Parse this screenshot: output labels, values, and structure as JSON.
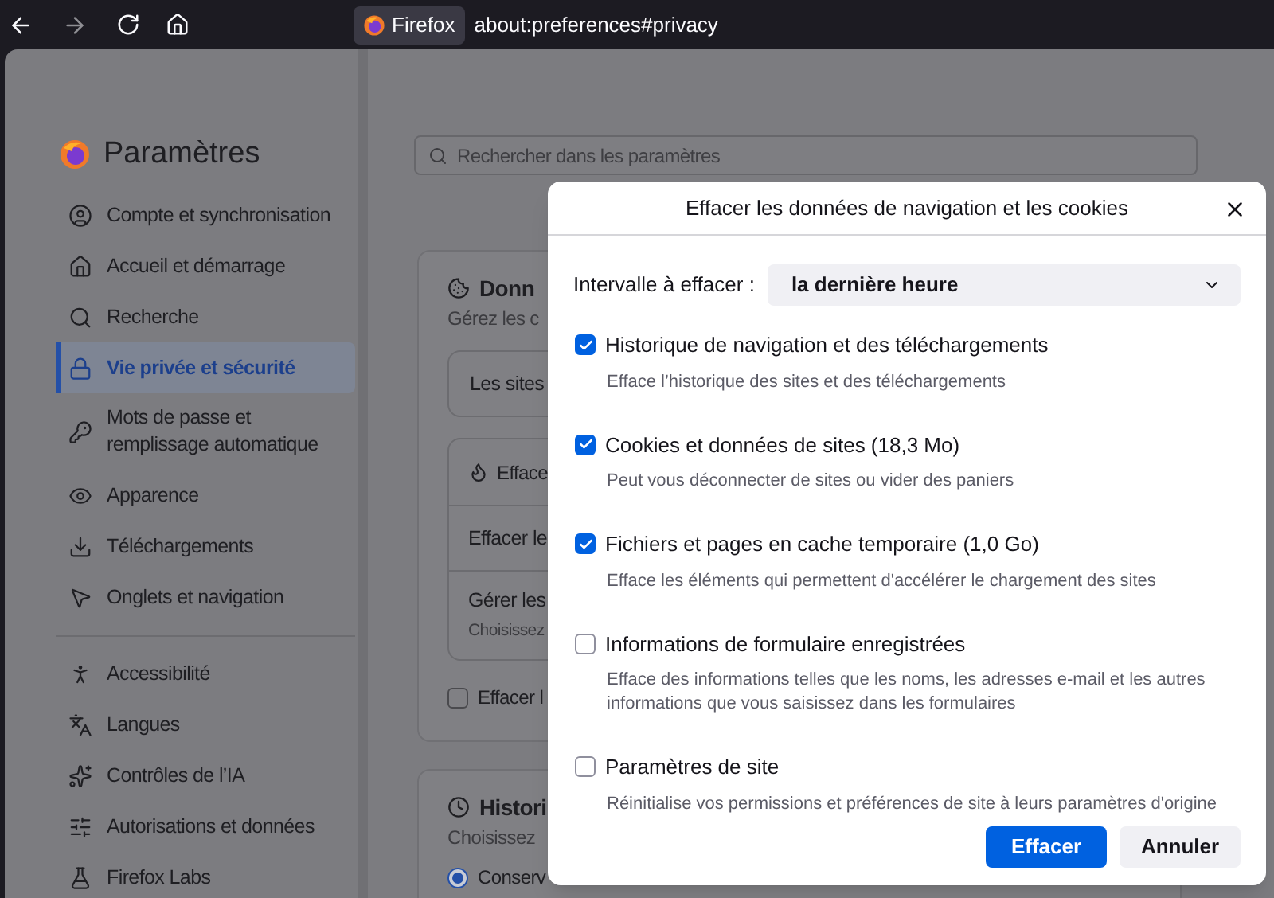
{
  "browser": {
    "identity": "Firefox",
    "url": "about:preferences#privacy"
  },
  "sidebar": {
    "title": "Paramètres",
    "groups": [
      [
        {
          "label": "Compte et synchronisation",
          "selected": false
        },
        {
          "label": "Accueil et démarrage",
          "selected": false
        },
        {
          "label": "Recherche",
          "selected": false
        },
        {
          "label": "Vie privée et sécurité",
          "selected": true
        },
        {
          "label": "Mots de passe et remplissage automatique",
          "selected": false
        },
        {
          "label": "Apparence",
          "selected": false
        },
        {
          "label": "Téléchargements",
          "selected": false
        },
        {
          "label": "Onglets et navigation",
          "selected": false
        }
      ],
      [
        {
          "label": "Accessibilité",
          "selected": false
        },
        {
          "label": "Langues",
          "selected": false
        },
        {
          "label": "Contrôles de l’IA",
          "selected": false
        },
        {
          "label": "Autorisations et données",
          "selected": false
        },
        {
          "label": "Firefox Labs",
          "selected": false
        }
      ]
    ]
  },
  "search": {
    "placeholder": "Rechercher dans les paramètres"
  },
  "content": {
    "data_card": {
      "title": "Donn",
      "subtitle": "Gérez les c",
      "sites_box": "Les sites",
      "rows": [
        {
          "label": "Efface"
        },
        {
          "label": "Effacer le"
        },
        {
          "label": "Gérer les",
          "sub": "Choisissez"
        }
      ],
      "checkbox": {
        "label": "Effacer l",
        "checked": false
      }
    },
    "history_card": {
      "title": "Histori",
      "subtitle": "Choisissez",
      "radio": {
        "label": "Conserv",
        "selected": true
      }
    }
  },
  "dialog": {
    "title": "Effacer les données de navigation et les cookies",
    "range_label": "Intervalle à effacer :",
    "range_value": "la dernière heure",
    "options": [
      {
        "label": "Historique de navigation et des téléchargements",
        "description": "Efface l’historique des sites et des téléchargements",
        "checked": true
      },
      {
        "label": "Cookies et données de sites (18,3 Mo)",
        "description": "Peut vous déconnecter de sites ou vider des paniers",
        "checked": true
      },
      {
        "label": "Fichiers et pages en cache temporaire (1,0 Go)",
        "description": "Efface les éléments qui permettent d'accélérer le chargement des sites",
        "checked": true
      },
      {
        "label": "Informations de formulaire enregistrées",
        "description": "Efface des informations telles que les noms, les adresses e-mail et les autres informations que vous saisissez dans les formulaires",
        "checked": false
      },
      {
        "label": "Paramètres de site",
        "description": "Réinitialise vos permissions et préférences de site à leurs paramètres d'origine",
        "checked": false
      }
    ],
    "buttons": [
      "Effacer",
      "Annuler"
    ]
  }
}
